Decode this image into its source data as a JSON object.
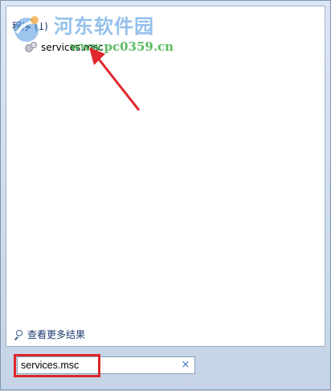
{
  "results": {
    "group_header": "程序 (1)",
    "items": [
      {
        "label": "services.msc",
        "icon": "services-gear-icon"
      }
    ]
  },
  "see_more": {
    "label": "查看更多结果",
    "icon": "search-icon"
  },
  "search": {
    "value": "services.msc",
    "clear_glyph": "×"
  },
  "watermark": {
    "title": "河东软件园",
    "url": "www.pc0359.cn"
  },
  "colors": {
    "annotation_red": "#e0262a",
    "link_blue": "#1e3b6e"
  }
}
